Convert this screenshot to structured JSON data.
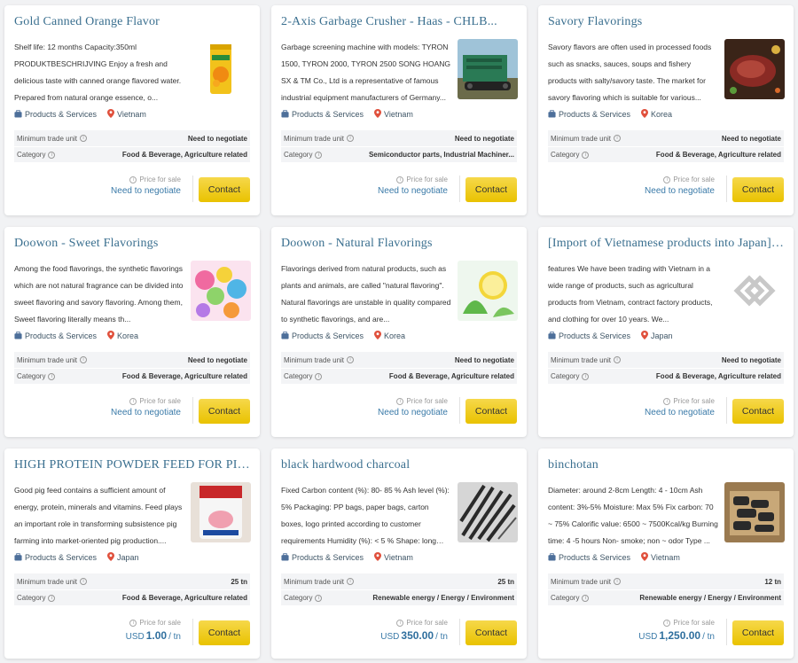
{
  "labels": {
    "min_trade_unit": "Minimum trade unit",
    "category": "Category",
    "price_for_sale": "Price for sale",
    "contact": "Contact",
    "products_services": "Products & Services"
  },
  "colors": {
    "title": "#3a6f8f",
    "button": "#f0cc1c",
    "location_pin": "#e0503c",
    "price": "#2f6f9e"
  },
  "cards": [
    {
      "title": "Gold Canned Orange Flavor",
      "description": "Shelf life: 12 months Capacity:350ml PRODUKTBESCHRIJVING Enjoy a fresh and delicious taste with canned orange flavored water. Prepared from natural orange essence, o...",
      "location": "Vietnam",
      "min_trade_unit": "Need to negotiate",
      "category": "Food & Beverage, Agriculture related",
      "price_prefix": "",
      "price_value": "Need to negotiate",
      "price_suffix": "",
      "image": "canned-drink"
    },
    {
      "title": "2-Axis Garbage Crusher - Haas - CHLB...",
      "description": "Garbage screening machine with models: TYRON 1500, TYRON 2000, TYRON 2500 SONG HOANG SX & TM Co., Ltd is a representative of famous industrial equipment manufacturers of Germany...",
      "location": "Vietnam",
      "min_trade_unit": "Need to negotiate",
      "category": "Semiconductor parts, Industrial Machiner...",
      "price_prefix": "",
      "price_value": "Need to negotiate",
      "price_suffix": "",
      "image": "machine"
    },
    {
      "title": "Savory Flavorings",
      "description": "Savory flavors are often used in processed foods such as snacks, sauces, soups and fishery products with salty/savory taste. The market for savory flavoring which is suitable for various...",
      "location": "Korea",
      "min_trade_unit": "Need to negotiate",
      "category": "Food & Beverage, Agriculture related",
      "price_prefix": "",
      "price_value": "Need to negotiate",
      "price_suffix": "",
      "image": "meat"
    },
    {
      "title": "Doowon - Sweet Flavorings",
      "description": "Among the food flavorings, the synthetic flavorings which are not natural fragrance can be divided into sweet flavoring and savory flavoring. Among them, Sweet flavoring literally means th...",
      "location": "Korea",
      "min_trade_unit": "Need to negotiate",
      "category": "Food & Beverage, Agriculture related",
      "price_prefix": "",
      "price_value": "Need to negotiate",
      "price_suffix": "",
      "image": "candy"
    },
    {
      "title": "Doowon - Natural Flavorings",
      "description": "Flavorings derived from natural products, such as plants and animals, are called \"natural flavoring\". Natural flavorings are unstable in quality compared to synthetic flavorings, and are...",
      "location": "Korea",
      "min_trade_unit": "Need to negotiate",
      "category": "Food & Beverage, Agriculture related",
      "price_prefix": "",
      "price_value": "Need to negotiate",
      "price_suffix": "",
      "image": "lemon"
    },
    {
      "title": "[Import of Vietnamese products into Japan] Ov...",
      "description": "features We have been trading with Vietnam in a wide range of products, such as agricultural products from Vietnam, contract factory products, and clothing for over 10 years. We...",
      "location": "Japan",
      "min_trade_unit": "Need to negotiate",
      "category": "Food & Beverage, Agriculture related",
      "price_prefix": "",
      "price_value": "Need to negotiate",
      "price_suffix": "",
      "image": "logo"
    },
    {
      "title": "HIGH PROTEIN POWDER FEED FOR PIG +...",
      "description": "Good pig feed contains a sufficient amount of energy, protein, minerals and vitamins. Feed plays an important role in transforming subsistence pig farming into market-oriented pig production....",
      "location": "Japan",
      "min_trade_unit": "25 tn",
      "category": "Food & Beverage, Agriculture related",
      "price_prefix": "USD",
      "price_value": "1.00",
      "price_suffix": "/ tn",
      "image": "feed-bag"
    },
    {
      "title": "black hardwood charcoal",
      "description": "Fixed Carbon content (%): 80- 85 % Ash level (%): 5% Packaging: PP bags, paper bags, carton boxes, logo printed according to customer requirements Humidity (%): < 5 % Shape: long round stick He...",
      "location": "Vietnam",
      "min_trade_unit": "25 tn",
      "category": "Renewable energy / Energy / Environment",
      "price_prefix": "USD",
      "price_value": "350.00",
      "price_suffix": "/ tn",
      "image": "charcoal-sticks"
    },
    {
      "title": "binchotan",
      "description": "Diameter: around 2-8cm Length: 4 - 10cm Ash content: 3%-5% Moisture: Max 5% Fix carbon: 70 ~ 75% Calorific value: 6500 ~ 7500Kcal/kg Burning time: 4 -5 hours Non- smoke; non ~ odor Type ...",
      "location": "Vietnam",
      "min_trade_unit": "12 tn",
      "category": "Renewable energy / Energy / Environment",
      "price_prefix": "USD",
      "price_value": "1,250.00",
      "price_suffix": "/ tn",
      "image": "charcoal-box"
    }
  ]
}
